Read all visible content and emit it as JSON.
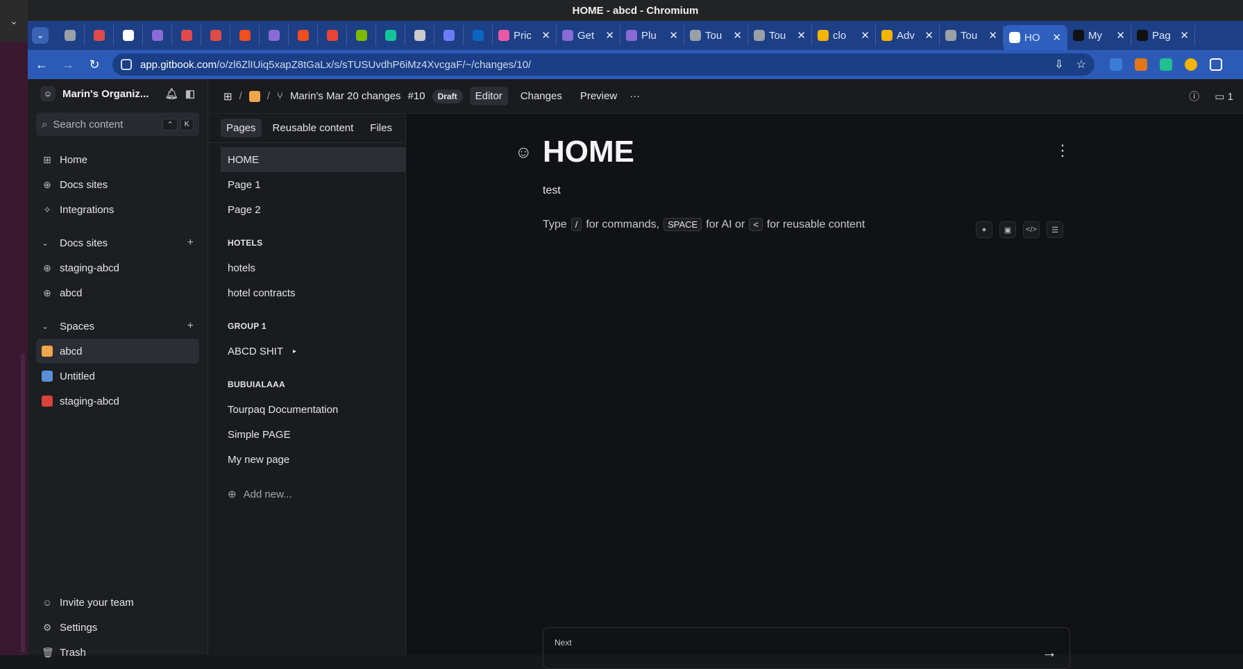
{
  "window": {
    "title": "HOME - abcd - Chromium"
  },
  "tabs": {
    "icons": [
      "globe-icon",
      "record-icon",
      "github-icon",
      "copilot-icon",
      "redirect-icon",
      "redirect-icon",
      "figma-icon",
      "copilot-icon",
      "figma-icon",
      "chrome-icon",
      "microsoft-icon",
      "grammarly-icon",
      "target-icon",
      "check-icon",
      "outlook-icon"
    ],
    "text_tabs": [
      {
        "label": "Pric",
        "color": "#e85aa6"
      },
      {
        "label": "Get",
        "color": "#8a6bd6"
      },
      {
        "label": "Plu",
        "color": "#8a6bd6"
      },
      {
        "label": "Tou",
        "color": "#9aa0a6"
      },
      {
        "label": "Tou",
        "color": "#9aa0a6"
      },
      {
        "label": "clo",
        "color": "#f4b400"
      },
      {
        "label": "Adv",
        "color": "#f4b400"
      },
      {
        "label": "Tou",
        "color": "#9aa0a6"
      },
      {
        "label": "HO",
        "color": "#ffffff",
        "active": true
      },
      {
        "label": "My",
        "color": "#111111"
      },
      {
        "label": "Pag",
        "color": "#111111"
      }
    ],
    "close": "✕"
  },
  "address": {
    "url_host": "app.gitbook.com",
    "url_path": "/o/zl6ZlIUiq5xapZ8tGaLx/s/sTUSUvdhP6iMz4XvcgaF/~/changes/10/"
  },
  "org": {
    "name": "Marin's Organiz..."
  },
  "search": {
    "placeholder": "Search content",
    "k1": "⌃",
    "k2": "K"
  },
  "sidebar": {
    "nav": [
      "Home",
      "Docs sites",
      "Integrations"
    ],
    "docs_sites_label": "Docs sites",
    "docs_sites": [
      "staging-abcd",
      "abcd"
    ],
    "spaces_label": "Spaces",
    "spaces": [
      {
        "label": "abcd",
        "color": "#f0a64a",
        "active": true
      },
      {
        "label": "Untitled",
        "color": "#5a8fd6"
      },
      {
        "label": "staging-abcd",
        "color": "#d9433b"
      }
    ],
    "bottom": [
      "Invite your team",
      "Settings",
      "Trash"
    ]
  },
  "topbar": {
    "title": "Marin's Mar 20 changes",
    "num": "#10",
    "badge": "Draft",
    "tabs": [
      "Editor",
      "Changes",
      "Preview"
    ],
    "more": "···",
    "comments": "1"
  },
  "pages_panel": {
    "tabs": [
      "Pages",
      "Reusable content",
      "Files"
    ],
    "top_pages": [
      "HOME",
      "Page 1",
      "Page 2"
    ],
    "groups": [
      {
        "title": "HOTELS",
        "items": [
          "hotels",
          "hotel contracts"
        ]
      },
      {
        "title": "GROUP 1",
        "items": [
          "ABCD SHIT"
        ]
      },
      {
        "title": "BUBUIALAAA",
        "items": [
          "Tourpaq Documentation",
          "Simple PAGE",
          "My new page"
        ]
      }
    ],
    "add_new": "Add new..."
  },
  "doc": {
    "title": "HOME",
    "subtitle": "test",
    "hint": {
      "t1": "Type",
      "k1": "/",
      "t2": "for commands,",
      "k2": "SPACE",
      "t3": "for AI or",
      "k3": "<",
      "t4": "for reusable content"
    },
    "next_label": "Next"
  }
}
